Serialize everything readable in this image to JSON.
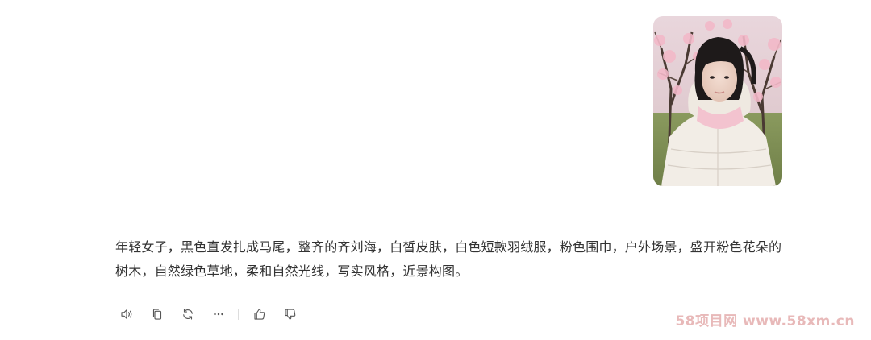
{
  "message": {
    "image_description_icon": "photo-thumbnail",
    "reply_text": "年轻女子，黑色直发扎成马尾，整齐的齐刘海，白皙皮肤，白色短款羽绒服，粉色围巾，户外场景，盛开粉色花朵的树木，自然绿色草地，柔和自然光线，写实风格，近景构图。"
  },
  "toolbar": {
    "icons": [
      "speaker-icon",
      "copy-icon",
      "regenerate-icon",
      "more-icon",
      "thumbs-up-icon",
      "thumbs-down-icon"
    ]
  },
  "watermark": {
    "text": "58项目网 www.58xm.cn",
    "color": "#e8b9b9"
  }
}
